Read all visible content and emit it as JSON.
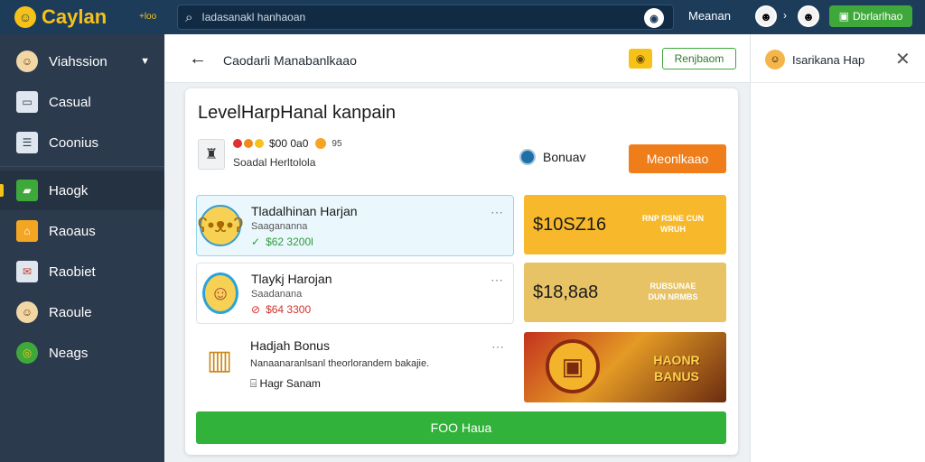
{
  "app": {
    "name": "Caylan",
    "tag": "+loo"
  },
  "search": {
    "placeholder": "Iadasanakl hanhaoan"
  },
  "topbar": {
    "user_name": "Meanan",
    "dashboard_label": "Dbrlarlhao"
  },
  "sidebar": {
    "items": [
      {
        "label": "Viahssion",
        "icon": "avatar-icon"
      },
      {
        "label": "Casual",
        "icon": "casual-icon"
      },
      {
        "label": "Coonius",
        "icon": "coins-icon"
      },
      {
        "label": "Haogk",
        "icon": "folder-icon"
      },
      {
        "label": "Raoaus",
        "icon": "house-icon"
      },
      {
        "label": "Raobiet",
        "icon": "chat-icon"
      },
      {
        "label": "Raoule",
        "icon": "profile-icon"
      },
      {
        "label": "Neags",
        "icon": "target-icon"
      }
    ]
  },
  "header": {
    "title": "Caodarli Manabanlkaao",
    "outline_button": "Renjbaom"
  },
  "right_panel": {
    "title": "Isarikana Hap"
  },
  "card": {
    "title": "LevelHarpHanal kanpain",
    "price_main": "$00 0a0",
    "price_small": "95",
    "subtitle": "Soadal Herltolola",
    "radio_label": "Bonuav",
    "orange_button": "Meonlkaao",
    "rows": [
      {
        "title": "Tladalhinan Harjan",
        "sub": "Saagananna",
        "price": "$62 3200l"
      },
      {
        "title": "Tlaykj Harojan",
        "sub": "Saadanana",
        "price": "$64 3300"
      },
      {
        "title": "Hadjah Bonus",
        "desc": "Nanaanaranlsanl theorlorandem bakajie.",
        "extra": "Hagr Sanam"
      }
    ],
    "promos": [
      {
        "value": "$10SZ16",
        "tag": "RNP RSNE CUN WRUH",
        "color": "#f7b92b"
      },
      {
        "value": "$18,8a8",
        "tag": "RUBSUNAE DUN NRMBS",
        "color": "#e7c365"
      },
      {
        "value": "",
        "tag": "HAONR BANUS",
        "color": "#d6891c"
      }
    ],
    "green_button": "FOO Haua"
  }
}
